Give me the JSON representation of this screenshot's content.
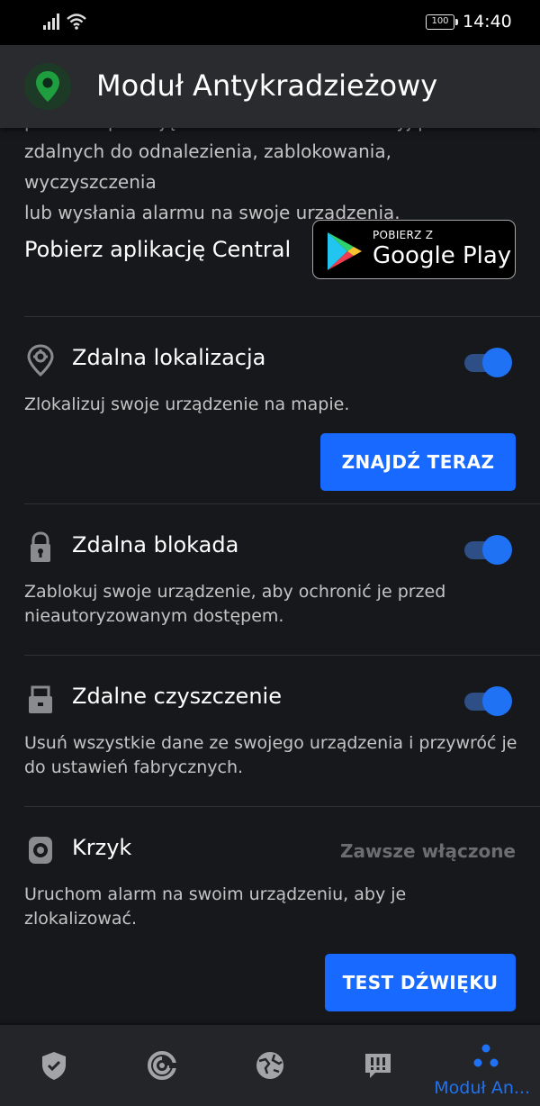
{
  "status_bar": {
    "time": "14:40",
    "battery": "100"
  },
  "app_bar": {
    "title": "Moduł Antykradzieżowy"
  },
  "intro": {
    "lines": [
      "pobierz aplikację Bitdefender Central i użyj poleceń",
      "zdalnych do odnalezienia, zablokowania, wyczyszczenia",
      "lub wysłania alarmu na swoje urządzenia."
    ]
  },
  "central": {
    "label": "Pobierz aplikację Central",
    "store_pre": "POBIERZ Z",
    "store_name": "Google Play"
  },
  "features": {
    "location": {
      "title": "Zdalna lokalizacja",
      "description": "Zlokalizuj swoje urządzenie na mapie.",
      "enabled": true,
      "action": "ZNAJDŹ TERAZ"
    },
    "lock": {
      "title": "Zdalna blokada",
      "description": "Zablokuj swoje urządzenie, aby ochronić je przed nieautoryzowanym dostępem.",
      "enabled": true
    },
    "wipe": {
      "title": "Zdalne czyszczenie",
      "description": "Usuń wszystkie dane ze swojego urządzenia i przywróć je do ustawień fabrycznych.",
      "enabled": true
    },
    "scream": {
      "title": "Krzyk",
      "status": "Zawsze włączone",
      "description": "Uruchom alarm na swoim urządzeniu, aby je zlokalizować.",
      "action": "TEST DŹWIĘKU"
    }
  },
  "bottom_nav": {
    "items": [
      {
        "icon": "shield-check-icon"
      },
      {
        "icon": "speedometer-icon"
      },
      {
        "icon": "globe-icon"
      },
      {
        "icon": "alerts-icon"
      },
      {
        "icon": "antitheft-dots-icon",
        "label": "Moduł An...",
        "active": true
      }
    ]
  },
  "colors": {
    "accent": "#1f72f4",
    "background": "#17181c",
    "appbar": "#2a2b2e",
    "muted_text": "#c4c4c4"
  }
}
